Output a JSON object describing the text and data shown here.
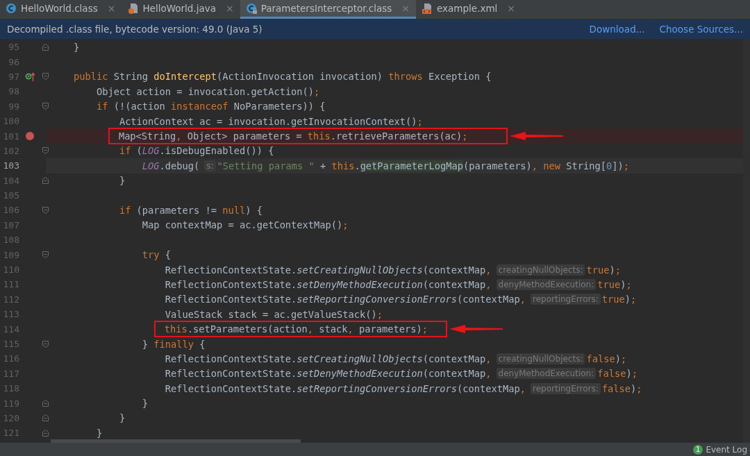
{
  "tabs": [
    {
      "label": "HelloWorld.class",
      "kind": "class",
      "selected": false,
      "close": "×"
    },
    {
      "label": "HelloWorld.java",
      "kind": "java",
      "selected": false,
      "close": "×"
    },
    {
      "label": "ParametersInterceptor.class",
      "kind": "locked",
      "selected": true,
      "close": "×"
    },
    {
      "label": "example.xml",
      "kind": "xml",
      "selected": false,
      "close": "×"
    }
  ],
  "banner": {
    "text": "Decompiled .class file, bytecode version: 49.0 (Java 5)",
    "links": [
      "Download...",
      "Choose Sources..."
    ]
  },
  "lines": [
    {
      "number": "95",
      "fold_start": false,
      "fold_end": true,
      "override": false,
      "breakpoint": false,
      "current": false,
      "annotated": false,
      "tokens": [
        {
          "kind": "plain",
          "text": "    }"
        }
      ]
    },
    {
      "number": "96",
      "fold_start": false,
      "fold_end": false,
      "override": false,
      "breakpoint": false,
      "current": false,
      "annotated": false
    },
    {
      "number": "97",
      "fold_start": true,
      "fold_end": false,
      "override": true,
      "breakpoint": false,
      "current": false,
      "annotated": false,
      "tokens": [
        {
          "kind": "keyword",
          "text": "    public"
        },
        {
          "kind": "plain",
          "text": " String "
        },
        {
          "kind": "decl",
          "text": "doIntercept"
        },
        {
          "kind": "plain",
          "text": "(ActionInvocation invocation) "
        },
        {
          "kind": "keyword",
          "text": "throws"
        },
        {
          "kind": "plain",
          "text": " Exception {"
        }
      ]
    },
    {
      "number": "98",
      "fold_start": false,
      "fold_end": false,
      "override": false,
      "breakpoint": false,
      "current": false,
      "annotated": false,
      "tokens": [
        {
          "kind": "plain",
          "text": "        Object action = invocation.getAction()"
        },
        {
          "kind": "keyword",
          "text": ";"
        }
      ]
    },
    {
      "number": "99",
      "fold_start": true,
      "fold_end": false,
      "override": false,
      "breakpoint": false,
      "current": false,
      "annotated": false,
      "tokens": [
        {
          "kind": "keyword",
          "text": "        if"
        },
        {
          "kind": "plain",
          "text": " (!(action "
        },
        {
          "kind": "keyword",
          "text": "instanceof"
        },
        {
          "kind": "plain",
          "text": " NoParameters)) {"
        }
      ]
    },
    {
      "number": "100",
      "fold_start": false,
      "fold_end": false,
      "override": false,
      "breakpoint": false,
      "current": false,
      "annotated": false,
      "tokens": [
        {
          "kind": "plain",
          "text": "            ActionContext ac = invocation.getInvocationContext()"
        },
        {
          "kind": "keyword",
          "text": ";"
        }
      ]
    },
    {
      "number": "101",
      "fold_start": false,
      "fold_end": false,
      "override": false,
      "breakpoint": true,
      "current": false,
      "annotated": true,
      "tokens": [
        {
          "kind": "plain",
          "text": "            Map<String"
        },
        {
          "kind": "keyword",
          "text": ","
        },
        {
          "kind": "plain",
          "text": " Object> parameters = "
        },
        {
          "kind": "keyword",
          "text": "this"
        },
        {
          "kind": "plain",
          "text": ".retrieveParameters(ac)"
        },
        {
          "kind": "keyword",
          "text": ";"
        }
      ]
    },
    {
      "number": "102",
      "fold_start": true,
      "fold_end": false,
      "override": false,
      "breakpoint": false,
      "current": false,
      "annotated": false,
      "tokens": [
        {
          "kind": "keyword",
          "text": "            if"
        },
        {
          "kind": "plain",
          "text": " ("
        },
        {
          "kind": "field",
          "text": "LOG"
        },
        {
          "kind": "plain",
          "text": ".isDebugEnabled()) {"
        }
      ]
    },
    {
      "number": "103",
      "fold_start": false,
      "fold_end": false,
      "override": false,
      "breakpoint": false,
      "current": true,
      "annotated": false,
      "tokens": [
        {
          "kind": "field",
          "text": "                LOG"
        },
        {
          "kind": "plain",
          "text": ".debug("
        },
        {
          "kind": "hint",
          "text": "s:"
        },
        {
          "kind": "string",
          "text": "\"Setting params \""
        },
        {
          "kind": "plain",
          "text": " + "
        },
        {
          "kind": "keyword",
          "text": "this"
        },
        {
          "kind": "plain",
          "text": "."
        },
        {
          "kind": "match",
          "text": "getParameterLogMap"
        },
        {
          "kind": "plain",
          "text": "(parameters)"
        },
        {
          "kind": "keyword",
          "text": ", new"
        },
        {
          "kind": "plain",
          "text": " String["
        },
        {
          "kind": "number",
          "text": "0"
        },
        {
          "kind": "plain",
          "text": "])"
        },
        {
          "kind": "keyword",
          "text": ";"
        }
      ]
    },
    {
      "number": "104",
      "fold_start": false,
      "fold_end": true,
      "override": false,
      "breakpoint": false,
      "current": false,
      "annotated": false,
      "tokens": [
        {
          "kind": "plain",
          "text": "            }"
        }
      ]
    },
    {
      "number": "105",
      "fold_start": false,
      "fold_end": false,
      "override": false,
      "breakpoint": false,
      "current": false,
      "annotated": false
    },
    {
      "number": "106",
      "fold_start": true,
      "fold_end": false,
      "override": false,
      "breakpoint": false,
      "current": false,
      "annotated": false,
      "tokens": [
        {
          "kind": "keyword",
          "text": "            if"
        },
        {
          "kind": "plain",
          "text": " (parameters != "
        },
        {
          "kind": "keyword",
          "text": "null"
        },
        {
          "kind": "plain",
          "text": ") {"
        }
      ]
    },
    {
      "number": "107",
      "fold_start": false,
      "fold_end": false,
      "override": false,
      "breakpoint": false,
      "current": false,
      "annotated": false,
      "tokens": [
        {
          "kind": "plain",
          "text": "                Map contextMap = ac.getContextMap()"
        },
        {
          "kind": "keyword",
          "text": ";"
        }
      ]
    },
    {
      "number": "108",
      "fold_start": false,
      "fold_end": false,
      "override": false,
      "breakpoint": false,
      "current": false,
      "annotated": false
    },
    {
      "number": "109",
      "fold_start": true,
      "fold_end": false,
      "override": false,
      "breakpoint": false,
      "current": false,
      "annotated": false,
      "tokens": [
        {
          "kind": "keyword",
          "text": "                try"
        },
        {
          "kind": "plain",
          "text": " {"
        }
      ]
    },
    {
      "number": "110",
      "fold_start": false,
      "fold_end": false,
      "override": false,
      "breakpoint": false,
      "current": false,
      "annotated": false,
      "tokens": [
        {
          "kind": "plain",
          "text": "                    ReflectionContextState."
        },
        {
          "kind": "static",
          "text": "setCreatingNullObjects"
        },
        {
          "kind": "plain",
          "text": "(contextMap"
        },
        {
          "kind": "keyword",
          "text": ","
        },
        {
          "kind": "hint",
          "text": "creatingNullObjects:"
        },
        {
          "kind": "keyword",
          "text": "true"
        },
        {
          "kind": "plain",
          "text": ")"
        },
        {
          "kind": "keyword",
          "text": ";"
        }
      ]
    },
    {
      "number": "111",
      "fold_start": false,
      "fold_end": false,
      "override": false,
      "breakpoint": false,
      "current": false,
      "annotated": false,
      "tokens": [
        {
          "kind": "plain",
          "text": "                    ReflectionContextState."
        },
        {
          "kind": "static",
          "text": "setDenyMethodExecution"
        },
        {
          "kind": "plain",
          "text": "(contextMap"
        },
        {
          "kind": "keyword",
          "text": ","
        },
        {
          "kind": "hint",
          "text": "denyMethodExecution:"
        },
        {
          "kind": "keyword",
          "text": "true"
        },
        {
          "kind": "plain",
          "text": ")"
        },
        {
          "kind": "keyword",
          "text": ";"
        }
      ]
    },
    {
      "number": "112",
      "fold_start": false,
      "fold_end": false,
      "override": false,
      "breakpoint": false,
      "current": false,
      "annotated": false,
      "tokens": [
        {
          "kind": "plain",
          "text": "                    ReflectionContextState."
        },
        {
          "kind": "static",
          "text": "setReportingConversionErrors"
        },
        {
          "kind": "plain",
          "text": "(contextMap"
        },
        {
          "kind": "keyword",
          "text": ","
        },
        {
          "kind": "hint",
          "text": "reportingErrors:"
        },
        {
          "kind": "keyword",
          "text": "true"
        },
        {
          "kind": "plain",
          "text": ")"
        },
        {
          "kind": "keyword",
          "text": ";"
        }
      ]
    },
    {
      "number": "113",
      "fold_start": false,
      "fold_end": false,
      "override": false,
      "breakpoint": false,
      "current": false,
      "annotated": false,
      "tokens": [
        {
          "kind": "plain",
          "text": "                    ValueStack stack = ac.getValueStack()"
        },
        {
          "kind": "keyword",
          "text": ";"
        }
      ]
    },
    {
      "number": "114",
      "fold_start": false,
      "fold_end": false,
      "override": false,
      "breakpoint": false,
      "current": false,
      "annotated": true,
      "tokens": [
        {
          "kind": "keyword",
          "text": "                    this"
        },
        {
          "kind": "plain",
          "text": ".setParameters(action"
        },
        {
          "kind": "keyword",
          "text": ","
        },
        {
          "kind": "plain",
          "text": " stack"
        },
        {
          "kind": "keyword",
          "text": ","
        },
        {
          "kind": "plain",
          "text": " parameters)"
        },
        {
          "kind": "keyword",
          "text": ";"
        }
      ]
    },
    {
      "number": "115",
      "fold_start": true,
      "fold_end": false,
      "override": false,
      "breakpoint": false,
      "current": false,
      "annotated": false,
      "tokens": [
        {
          "kind": "plain",
          "text": "                } "
        },
        {
          "kind": "keyword",
          "text": "finally"
        },
        {
          "kind": "plain",
          "text": " {"
        }
      ]
    },
    {
      "number": "116",
      "fold_start": false,
      "fold_end": false,
      "override": false,
      "breakpoint": false,
      "current": false,
      "annotated": false,
      "tokens": [
        {
          "kind": "plain",
          "text": "                    ReflectionContextState."
        },
        {
          "kind": "static",
          "text": "setCreatingNullObjects"
        },
        {
          "kind": "plain",
          "text": "(contextMap"
        },
        {
          "kind": "keyword",
          "text": ","
        },
        {
          "kind": "hint",
          "text": "creatingNullObjects:"
        },
        {
          "kind": "keyword",
          "text": "false"
        },
        {
          "kind": "plain",
          "text": ")"
        },
        {
          "kind": "keyword",
          "text": ";"
        }
      ]
    },
    {
      "number": "117",
      "fold_start": false,
      "fold_end": false,
      "override": false,
      "breakpoint": false,
      "current": false,
      "annotated": false,
      "tokens": [
        {
          "kind": "plain",
          "text": "                    ReflectionContextState."
        },
        {
          "kind": "static",
          "text": "setDenyMethodExecution"
        },
        {
          "kind": "plain",
          "text": "(contextMap"
        },
        {
          "kind": "keyword",
          "text": ","
        },
        {
          "kind": "hint",
          "text": "denyMethodExecution:"
        },
        {
          "kind": "keyword",
          "text": "false"
        },
        {
          "kind": "plain",
          "text": ")"
        },
        {
          "kind": "keyword",
          "text": ";"
        }
      ]
    },
    {
      "number": "118",
      "fold_start": false,
      "fold_end": false,
      "override": false,
      "breakpoint": false,
      "current": false,
      "annotated": false,
      "tokens": [
        {
          "kind": "plain",
          "text": "                    ReflectionContextState."
        },
        {
          "kind": "static",
          "text": "setReportingConversionErrors"
        },
        {
          "kind": "plain",
          "text": "(contextMap"
        },
        {
          "kind": "keyword",
          "text": ","
        },
        {
          "kind": "hint",
          "text": "reportingErrors:"
        },
        {
          "kind": "keyword",
          "text": "false"
        },
        {
          "kind": "plain",
          "text": ")"
        },
        {
          "kind": "keyword",
          "text": ";"
        }
      ]
    },
    {
      "number": "119",
      "fold_start": false,
      "fold_end": true,
      "override": false,
      "breakpoint": false,
      "current": false,
      "annotated": false,
      "tokens": [
        {
          "kind": "plain",
          "text": "                }"
        }
      ]
    },
    {
      "number": "120",
      "fold_start": false,
      "fold_end": true,
      "override": false,
      "breakpoint": false,
      "current": false,
      "annotated": false,
      "tokens": [
        {
          "kind": "plain",
          "text": "            }"
        }
      ]
    },
    {
      "number": "121",
      "fold_start": false,
      "fold_end": true,
      "override": false,
      "breakpoint": false,
      "current": false,
      "annotated": false,
      "tokens": [
        {
          "kind": "plain",
          "text": "        }"
        }
      ]
    }
  ],
  "status_bar": {
    "badge": "1",
    "label": "Event Log"
  }
}
